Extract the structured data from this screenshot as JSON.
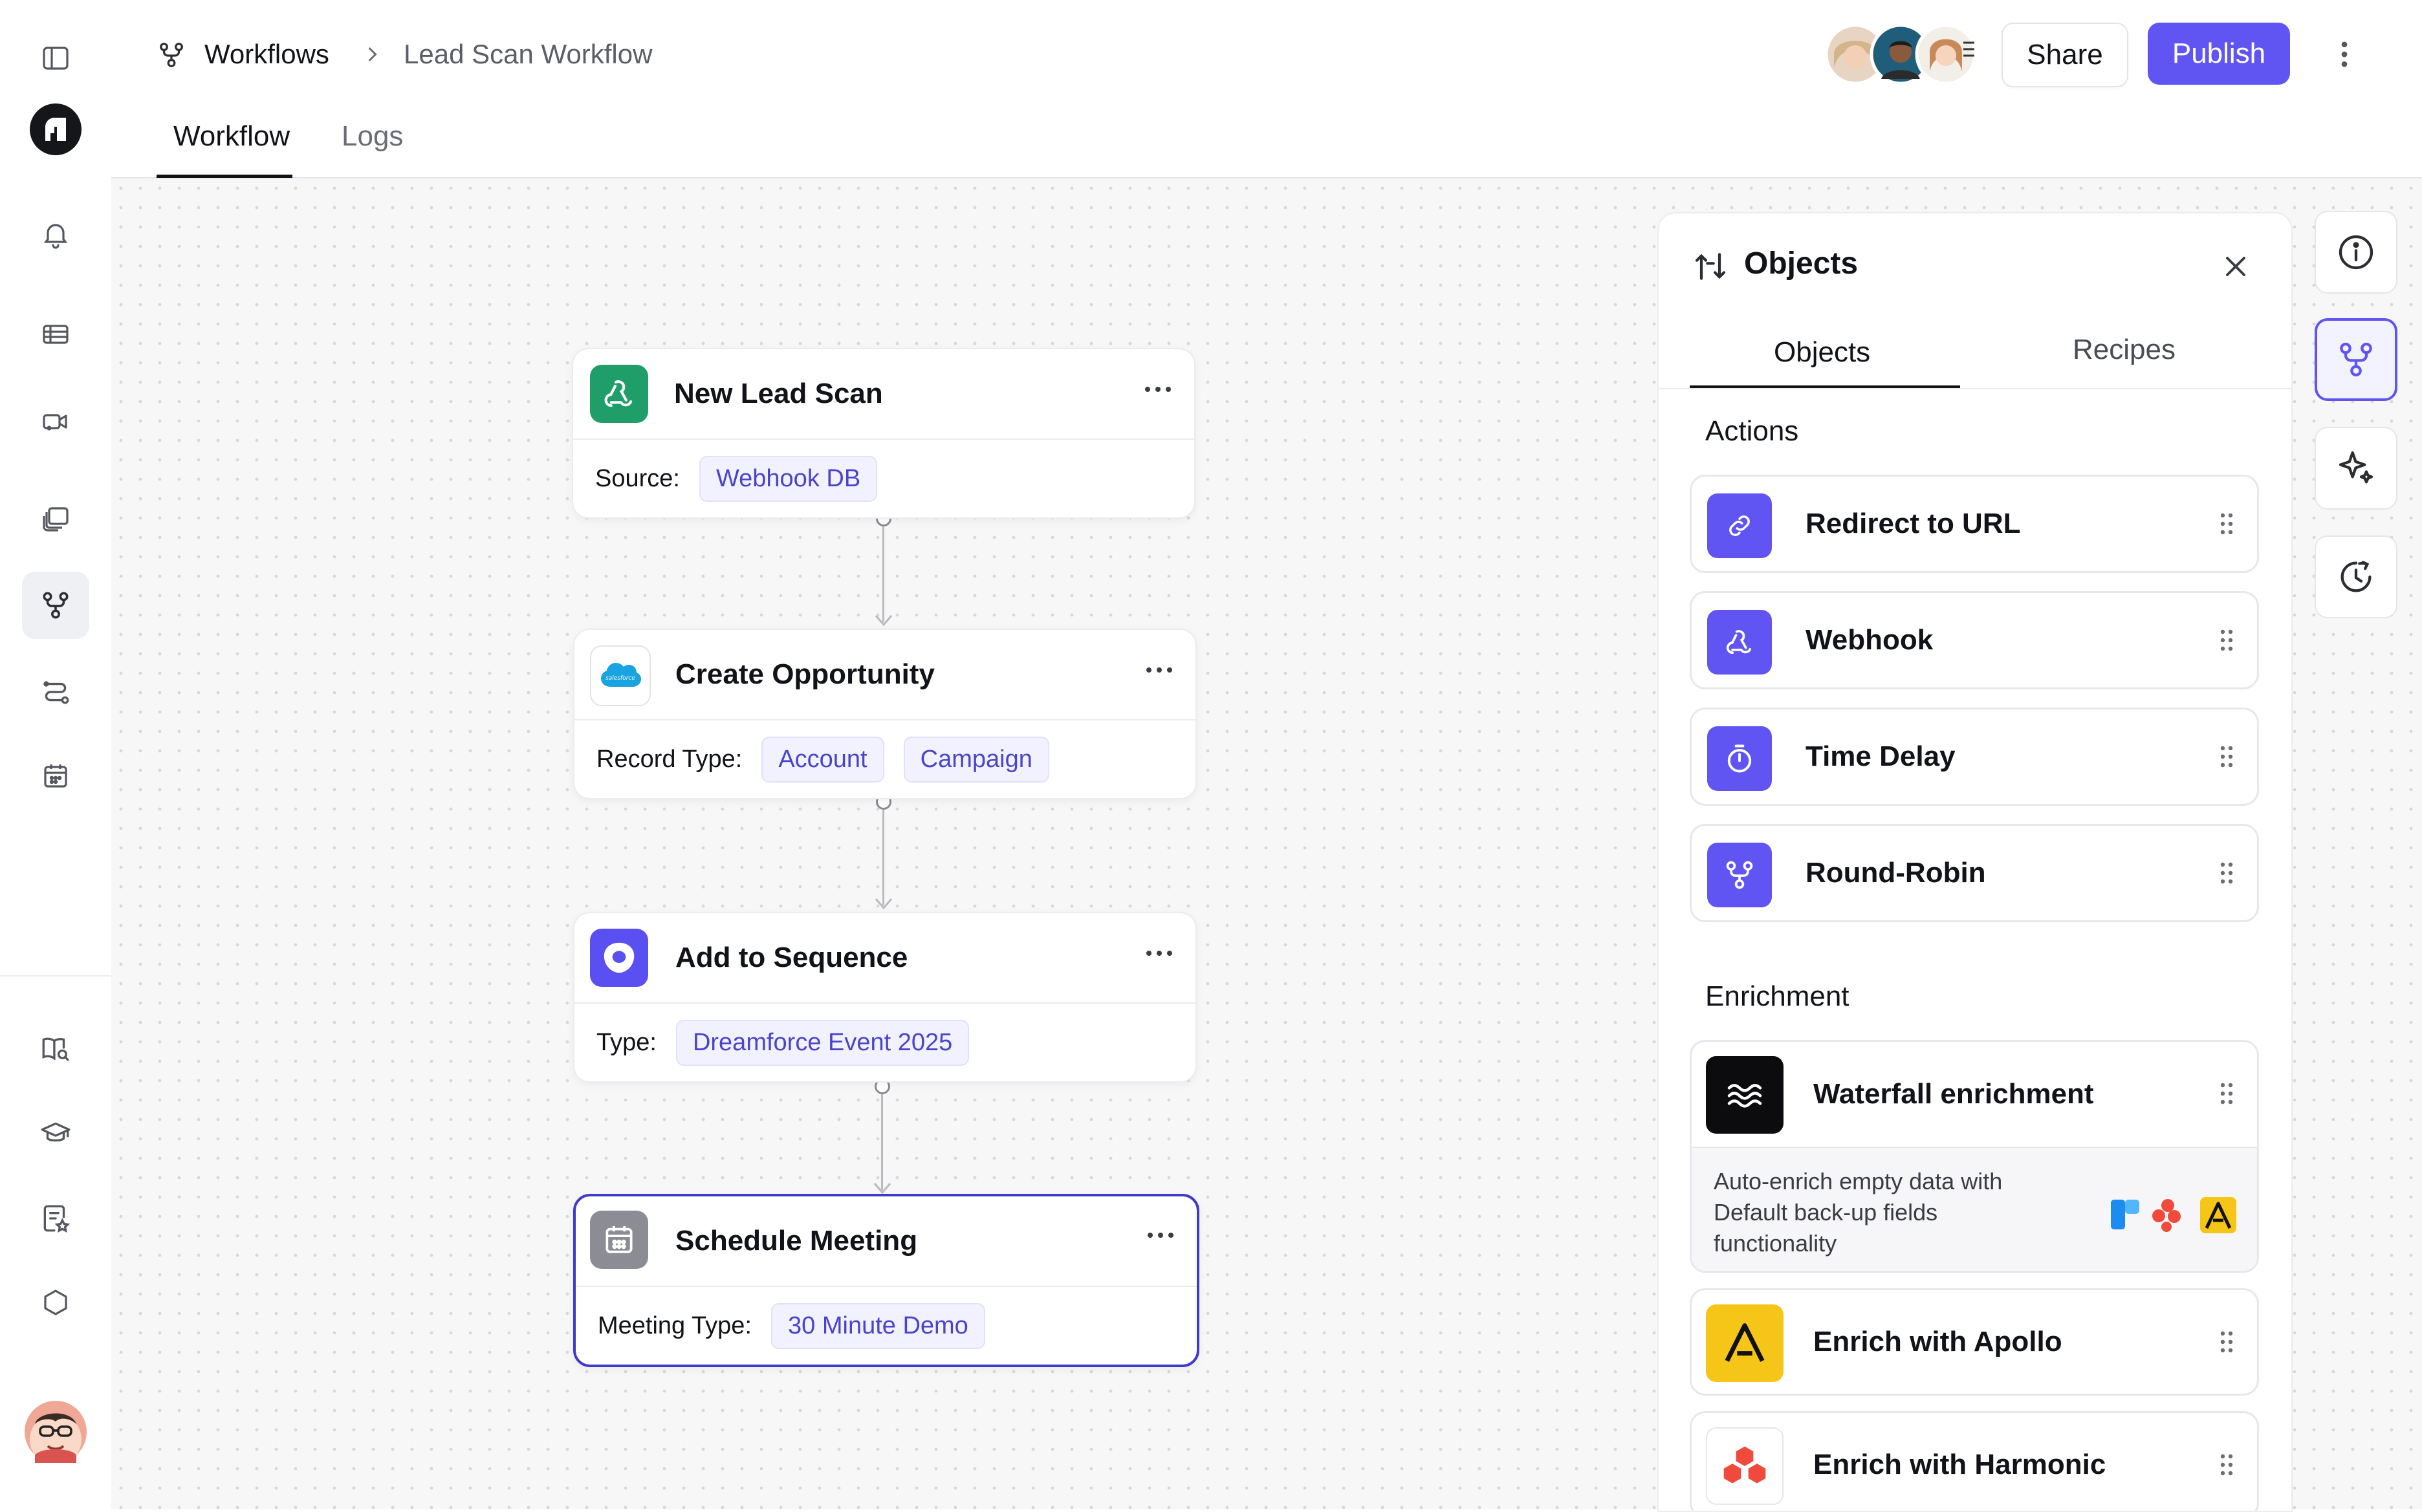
{
  "header": {
    "breadcrumb_root": "Workflows",
    "breadcrumb_current": "Lead Scan Workflow",
    "share_label": "Share",
    "publish_label": "Publish",
    "tabs": [
      {
        "label": "Workflow",
        "active": true
      },
      {
        "label": "Logs",
        "active": false
      }
    ]
  },
  "nodes": [
    {
      "title": "New Lead Scan",
      "field_label": "Source:",
      "chips": [
        "Webhook DB"
      ],
      "icon": "webhook-icon"
    },
    {
      "title": "Create Opportunity",
      "field_label": "Record Type:",
      "chips": [
        "Account",
        "Campaign"
      ],
      "icon": "salesforce-logo"
    },
    {
      "title": "Add to Sequence",
      "field_label": "Type:",
      "chips": [
        "Dreamforce Event 2025"
      ],
      "icon": "outreach-logo"
    },
    {
      "title": "Schedule Meeting",
      "field_label": "Meeting Type:",
      "chips": [
        "30 Minute Demo"
      ],
      "icon": "calendar-icon",
      "selected": true
    }
  ],
  "panel": {
    "title": "Objects",
    "tabs": [
      {
        "label": "Objects",
        "active": true
      },
      {
        "label": "Recipes",
        "active": false
      }
    ],
    "actions_title": "Actions",
    "actions": [
      {
        "label": "Redirect to URL",
        "icon": "link-icon"
      },
      {
        "label": "Webhook",
        "icon": "webhook-icon"
      },
      {
        "label": "Time Delay",
        "icon": "timer-icon"
      },
      {
        "label": "Round-Robin",
        "icon": "branch-icon"
      }
    ],
    "enrichment_title": "Enrichment",
    "waterfall": {
      "label": "Waterfall enrichment",
      "description_lines": [
        "Auto-enrich empty data with",
        "Default back-up fields",
        "functionality"
      ]
    },
    "enrichment_items": [
      {
        "label": "Enrich with Apollo",
        "icon": "apollo-logo"
      },
      {
        "label": "Enrich with Harmonic",
        "icon": "harmonic-logo"
      }
    ]
  },
  "colors": {
    "accent": "#6055f2",
    "chip_text": "#4a44c9",
    "selected_border": "#3f3ac9"
  }
}
